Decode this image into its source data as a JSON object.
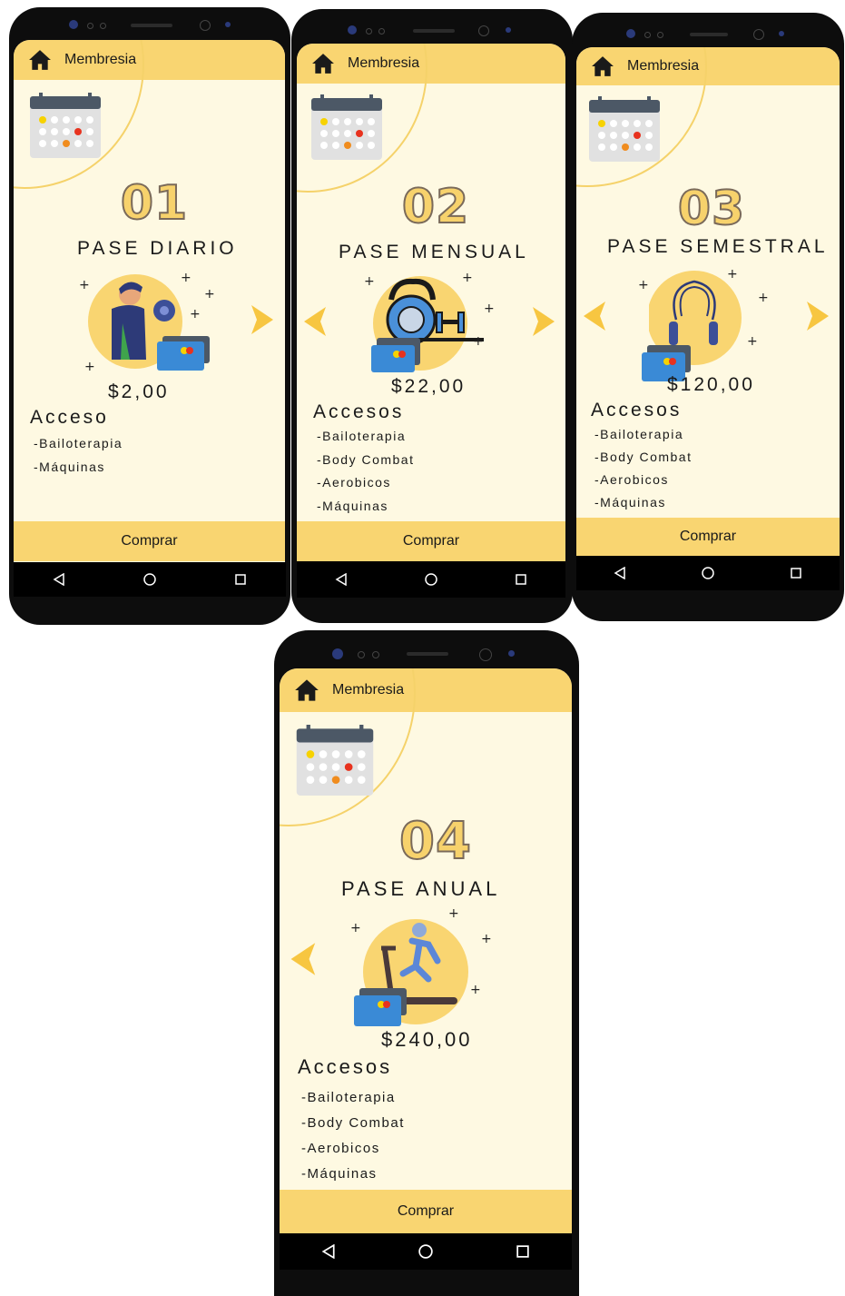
{
  "app": {
    "title": "Membresia",
    "buy_label": "Comprar"
  },
  "colors": {
    "accent": "#f9d571",
    "background": "#fef9e2",
    "number_fill": "#f7d26c"
  },
  "plans": [
    {
      "number": "01",
      "name": "PASE DIARIO",
      "price": "$2,00",
      "access_title": "Acceso",
      "items": [
        "-Bailoterapia",
        "-Máquinas"
      ],
      "illustration": "dumbbell-athlete-icon"
    },
    {
      "number": "02",
      "name": "PASE MENSUAL",
      "price": "$22,00",
      "access_title": "Accesos",
      "items": [
        "-Bailoterapia",
        "-Body Combat",
        "-Aerobicos",
        "-Máquinas"
      ],
      "illustration": "kettlebell-weights-icon"
    },
    {
      "number": "03",
      "name": "PASE SEMESTRAL",
      "price": "$120,00",
      "access_title": "Accesos",
      "items": [
        "-Bailoterapia",
        "-Body Combat",
        "-Aerobicos",
        "-Máquinas"
      ],
      "illustration": "jump-rope-icon"
    },
    {
      "number": "04",
      "name": "PASE ANUAL",
      "price": "$240,00",
      "access_title": "Accesos",
      "items": [
        "-Bailoterapia",
        "-Body Combat",
        "-Aerobicos",
        "-Máquinas"
      ],
      "illustration": "treadmill-runner-icon"
    }
  ],
  "icons": {
    "home": "home-icon",
    "calendar": "calendar-icon",
    "next": "chevron-right-icon",
    "prev": "chevron-left-icon",
    "back": "nav-back-icon",
    "home_nav": "nav-home-icon",
    "recents": "nav-recents-icon",
    "card": "credit-card-icon"
  }
}
